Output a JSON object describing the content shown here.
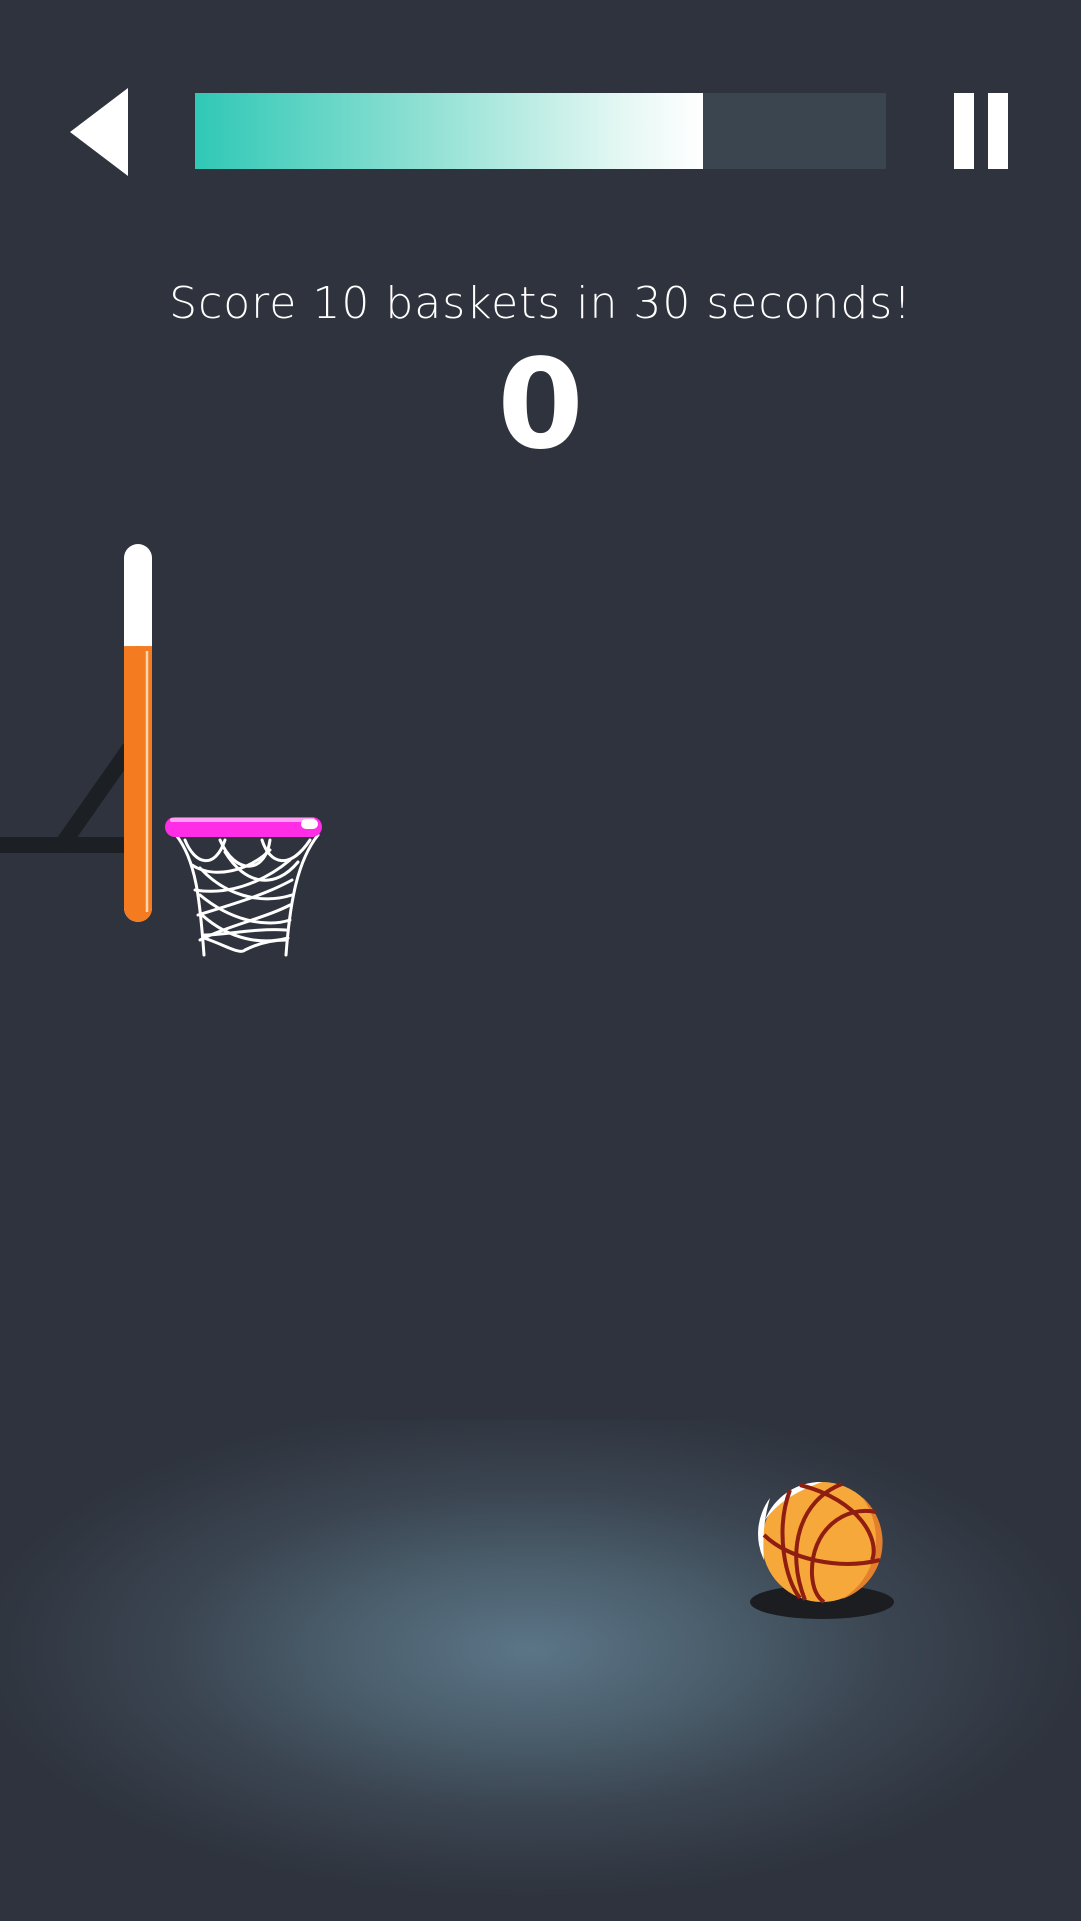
{
  "header": {
    "back_icon": "back-triangle-icon",
    "pause_icon": "pause-icon",
    "timer_progress": 0.735
  },
  "game": {
    "objective": "Score 10 baskets in 30 seconds!",
    "score": "0",
    "power_meter_fill": 0.73
  },
  "colors": {
    "background": "#2e333d",
    "timer_track": "#3b4550",
    "timer_start": "#30c8b6",
    "rim": "#ff2de6",
    "meter_fill": "#f47b20",
    "ball": "#f6a83a",
    "ball_seams": "#8f1d12"
  }
}
